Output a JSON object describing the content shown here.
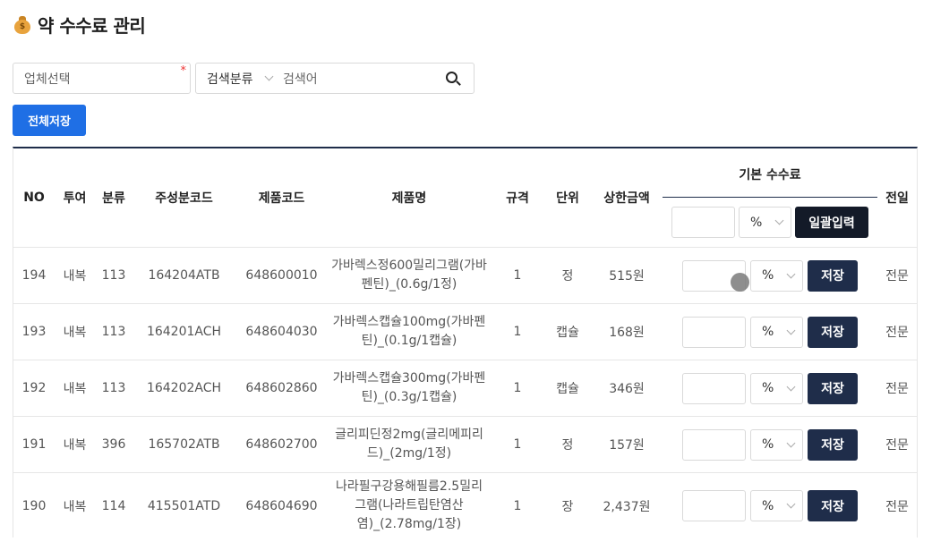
{
  "page": {
    "title": "약 수수료 관리",
    "title_icon": "money-bag-icon",
    "title_icon_glyph": "$"
  },
  "filters": {
    "company_placeholder": "업체선택",
    "required_mark": "*",
    "search_category": "검색분류",
    "search_placeholder": "검색어"
  },
  "toolbar": {
    "save_all_label": "전체저장"
  },
  "table": {
    "headers": {
      "no": "NO",
      "route": "투여",
      "class": "분류",
      "ingredient_code": "주성분코드",
      "product_code": "제품코드",
      "product_name": "제품명",
      "spec": "규격",
      "unit": "단위",
      "max_price": "상한금액",
      "base_fee": "기본 수수료",
      "special": "전일"
    },
    "bulk": {
      "unit": "%",
      "button": "일괄입력"
    },
    "row_unit": "%",
    "row_save_label": "저장",
    "rows": [
      {
        "no": "194",
        "route": "내복",
        "class": "113",
        "ingredient_code": "164204ATB",
        "product_code": "648600010",
        "name": "가바렉스정600밀리그램(가바펜틴)_(0.6g/1정)",
        "spec": "1",
        "unit": "정",
        "price": "515원",
        "special": "전문"
      },
      {
        "no": "193",
        "route": "내복",
        "class": "113",
        "ingredient_code": "164201ACH",
        "product_code": "648604030",
        "name": "가바렉스캡슐100mg(가바펜틴)_(0.1g/1캡슐)",
        "spec": "1",
        "unit": "캡슐",
        "price": "168원",
        "special": "전문"
      },
      {
        "no": "192",
        "route": "내복",
        "class": "113",
        "ingredient_code": "164202ACH",
        "product_code": "648602860",
        "name": "가바렉스캡슐300mg(가바펜틴)_(0.3g/1캡슐)",
        "spec": "1",
        "unit": "캡슐",
        "price": "346원",
        "special": "전문"
      },
      {
        "no": "191",
        "route": "내복",
        "class": "396",
        "ingredient_code": "165702ATB",
        "product_code": "648602700",
        "name": "글리피딘정2mg(글리메피리드)_(2mg/1정)",
        "spec": "1",
        "unit": "정",
        "price": "157원",
        "special": "전문"
      },
      {
        "no": "190",
        "route": "내복",
        "class": "114",
        "ingredient_code": "415501ATD",
        "product_code": "648604690",
        "name": "나라필구강용해필름2.5밀리그램(나라트립탄염산염)_(2.78mg/1장)",
        "spec": "1",
        "unit": "장",
        "price": "2,437원",
        "special": "전문"
      }
    ]
  },
  "colors": {
    "primary": "#1f6fe5",
    "navy": "#1f2d4a",
    "required": "#e33333"
  }
}
